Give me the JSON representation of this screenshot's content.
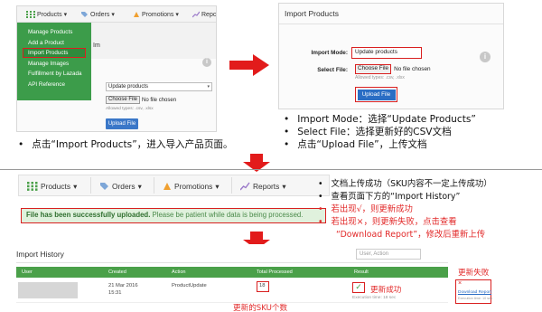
{
  "panel1": {
    "nav": [
      "Products",
      "Orders",
      "Promotions",
      "Repc"
    ],
    "menu_items": [
      "Manage Products",
      "Add a Product",
      "Import Products",
      "Manage Images",
      "Fulfillment by Lazada",
      "API Reference"
    ],
    "active_item": "Import Products",
    "page_title": "Im",
    "mode_value": "Update products",
    "choose_file": "Choose File",
    "no_file": "No file chosen",
    "allowed": "Allowed types: .csv, .xlsx",
    "upload": "Upload File",
    "info": "i",
    "caret": "▾"
  },
  "panel2": {
    "title": "Import Products",
    "import_mode_label": "Import Mode",
    "import_mode_value": "Update products",
    "select_file_label": "Select File",
    "choose_file": "Choose File",
    "no_file": "No file chosen",
    "allowed": "Allowed types: .csv, .xlsx",
    "upload": "Upload File",
    "info": "i",
    "caret": "▾"
  },
  "panel3": {
    "nav": [
      "Products",
      "Orders",
      "Promotions",
      "Reports"
    ],
    "success_strong": "File has been successfully uploaded.",
    "success_rest": "Please be patient while data is being processed."
  },
  "panel4": {
    "title": "Import History",
    "search_placeholder": "User, Action",
    "columns": [
      "User",
      "Created",
      "Action",
      "Total Processed",
      "Result"
    ],
    "row": {
      "created_date": "21 Mar 2016",
      "created_time": "15:31",
      "action": "ProductUpdate",
      "total": "18",
      "exec": "Execution time: 18 sec"
    }
  },
  "annotations": {
    "left_bullet": "点击“Import Products”，进入导入产品页面。",
    "right_bullets": [
      "Import Mode：选择“Update Products”",
      "Select File：选择更新好的CSV文档",
      "点击“Upload File”，上传文档"
    ],
    "status_bullets": [
      "文档上传成功（SKU内容不一定上传成功）",
      "查看页面下方的“Import History”"
    ],
    "red_bullets": [
      "若出现√，则更新成功",
      "若出现×，则更新失败，点击查看"
    ],
    "red_continue": "“Download Report”，修改后重新上传",
    "update_fail": "更新失败",
    "update_success": "更新成功",
    "sku_count": "更新的SKU个数",
    "download_report": "Download Report",
    "fail_exec": "Execution time: 10 sec",
    "fail_mark": "×",
    "check_mark": "✓"
  },
  "colors": {
    "accent_green": "#3c9c4a",
    "highlight_red": "#d92020",
    "annotation_red": "#e22a2a",
    "upload_blue": "#2a6dc4",
    "success_bg": "#e0f1dd"
  }
}
